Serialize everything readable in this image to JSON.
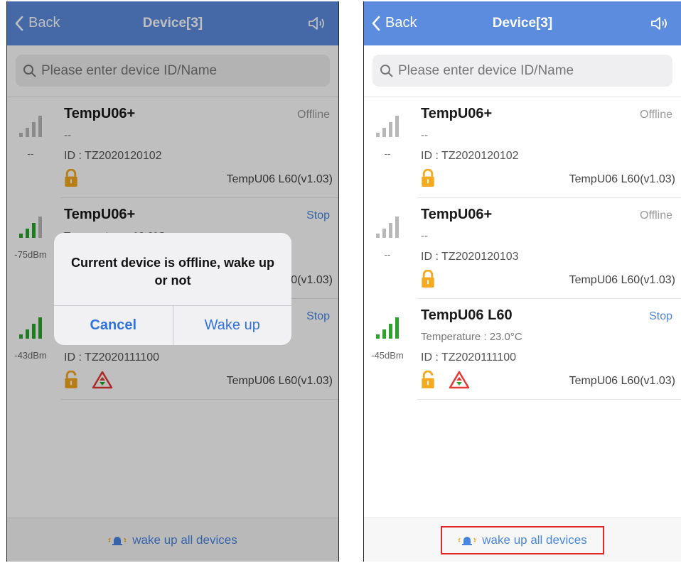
{
  "screens": [
    {
      "header": {
        "back_label": "Back",
        "title": "Device[3]"
      },
      "search": {
        "placeholder": "Please enter device ID/Name"
      },
      "devices": [
        {
          "name": "TempU06+",
          "status": "Offline",
          "line2": "--",
          "id": "ID : TZ2020120102",
          "rssi": "--",
          "model": "TempU06 L60(v1.03)"
        },
        {
          "name": "TempU06+",
          "status": "Stop",
          "line2": "Temperature : 19.0°C",
          "id": "",
          "rssi": "-75dBm",
          "model": "TempU06 L60(v1.03)"
        },
        {
          "name": "",
          "status": "Stop",
          "line2": "",
          "id": "ID : TZ2020111100",
          "rssi": "-43dBm",
          "model": "TempU06 L60(v1.03)"
        }
      ],
      "dialog": {
        "message": "Current device is offline, wake up or not",
        "cancel_label": "Cancel",
        "confirm_label": "Wake up"
      },
      "footer": {
        "wake_all_label": "wake up all devices"
      }
    },
    {
      "header": {
        "back_label": "Back",
        "title": "Device[3]"
      },
      "search": {
        "placeholder": "Please enter device ID/Name"
      },
      "devices": [
        {
          "name": "TempU06+",
          "status": "Offline",
          "line2": "--",
          "id": "ID : TZ2020120102",
          "rssi": "--",
          "model": "TempU06 L60(v1.03)"
        },
        {
          "name": "TempU06+",
          "status": "Offline",
          "line2": "--",
          "id": "ID : TZ2020120103",
          "rssi": "--",
          "model": "TempU06 L60(v1.03)"
        },
        {
          "name": "TempU06 L60",
          "status": "Stop",
          "line2": "Temperature : 23.0°C",
          "id": "ID : TZ2020111100",
          "rssi": "-45dBm",
          "model": "TempU06 L60(v1.03)"
        }
      ],
      "footer": {
        "wake_all_label": "wake up all devices"
      }
    }
  ],
  "colors": {
    "header": "#5b8cde",
    "accent": "#4a86e0",
    "signal_on": "#2aa52a",
    "signal_off": "#b8b8b8",
    "lock": "#f4a91e",
    "warning": "#e53935",
    "highlight": "#e02828"
  },
  "icons": [
    "back-chevron-icon",
    "speaker-icon",
    "search-icon",
    "signal-icon",
    "lock-icon",
    "unlock-icon",
    "warning-icon",
    "bell-icon"
  ]
}
